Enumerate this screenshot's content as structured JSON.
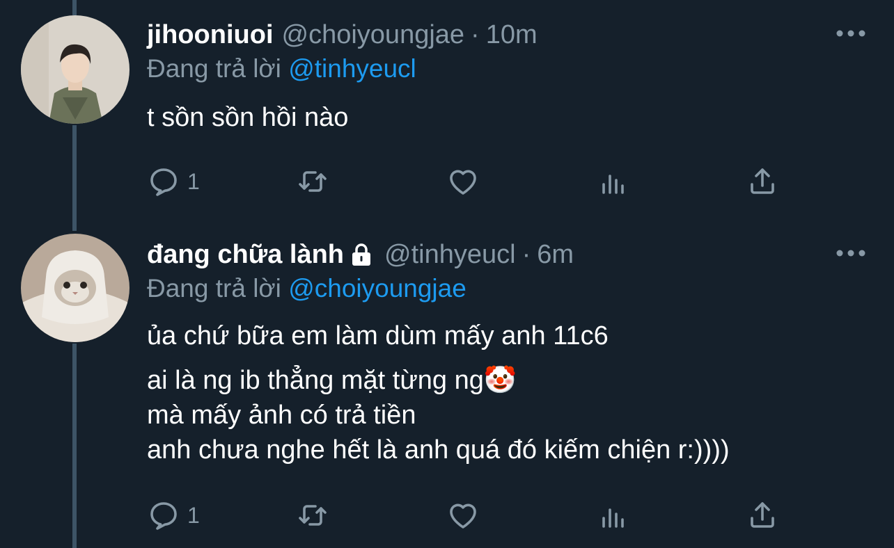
{
  "tweets": [
    {
      "display_name": "jihooniuoi",
      "handle": "@choiyoungjae",
      "time": "10m",
      "replying_label": "Đang trả lời",
      "replying_to": "@tinhyeucl",
      "text": [
        "t sồn sồn hồi nào"
      ],
      "reply_count": "1",
      "locked": false
    },
    {
      "display_name": "đang chữa lành",
      "handle": "@tinhyeucl",
      "time": "6m",
      "replying_label": "Đang trả lời",
      "replying_to": "@choiyoungjae",
      "text": [
        "ủa chứ bữa em làm dùm mấy anh 11c6",
        "ai là ng ib thẳng mặt từng ng🤡",
        "mà mấy ảnh có trả tiền",
        "anh chưa nghe hết là anh quá đó kiếm chiện r:))))"
      ],
      "reply_count": "1",
      "locked": true
    }
  ],
  "separator": "·",
  "icons": [
    "more-icon",
    "lock-icon",
    "reply-icon",
    "retweet-icon",
    "like-icon",
    "analytics-icon",
    "share-icon"
  ],
  "colors": {
    "background": "#15202b",
    "secondary_text": "#8899a6",
    "mention": "#1d9bf0",
    "thread_line": "#3d5466"
  }
}
